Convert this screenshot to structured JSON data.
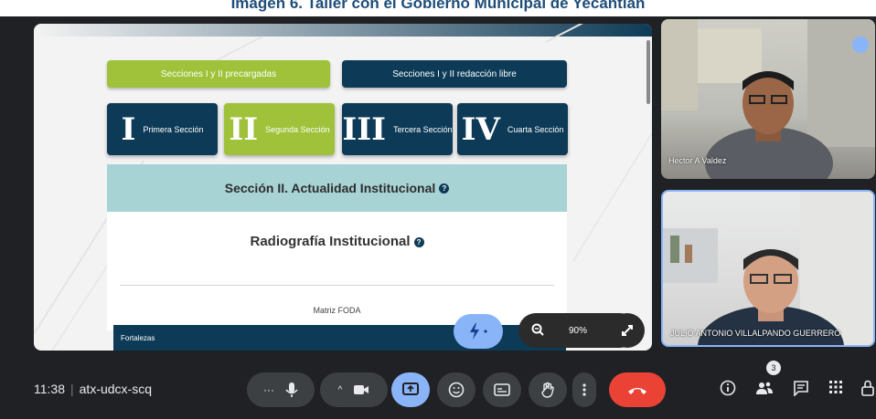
{
  "caption": "Imagen 6. Taller con el Gobierno Municipal de Yecantián",
  "share": {
    "tab_preloaded": "Secciones I y II precargadas",
    "tab_free": "Secciones I y II redacción libre",
    "sections": [
      {
        "numeral": "I",
        "label": "Primera Sección",
        "color": "#0d3b57"
      },
      {
        "numeral": "II",
        "label": "Segunda Sección",
        "color": "#9fc23a"
      },
      {
        "numeral": "III",
        "label": "Tercera Sección",
        "color": "#0d3b57"
      },
      {
        "numeral": "IV",
        "label": "Cuarta Sección",
        "color": "#0d3b57"
      }
    ],
    "section_header": "Sección II. Actualidad Institucional",
    "panel_title": "Radiografía Institucional",
    "matrix_title": "Matriz FODA",
    "fortalezas": "Fortalezas",
    "zoom_level": "90%"
  },
  "participants": [
    {
      "name": "Hector A Valdez"
    },
    {
      "name": "JULIO ANTONIO VILLALPANDO GUERRERO"
    }
  ],
  "meeting": {
    "time": "11:38",
    "code": "atx-udcx-scq",
    "participant_count": "3"
  },
  "colors": {
    "navy": "#0d3b57",
    "green": "#9fc23a",
    "teal": "#a8d3d4",
    "end_call": "#ea4335",
    "present_highlight": "#8ab4f8"
  }
}
